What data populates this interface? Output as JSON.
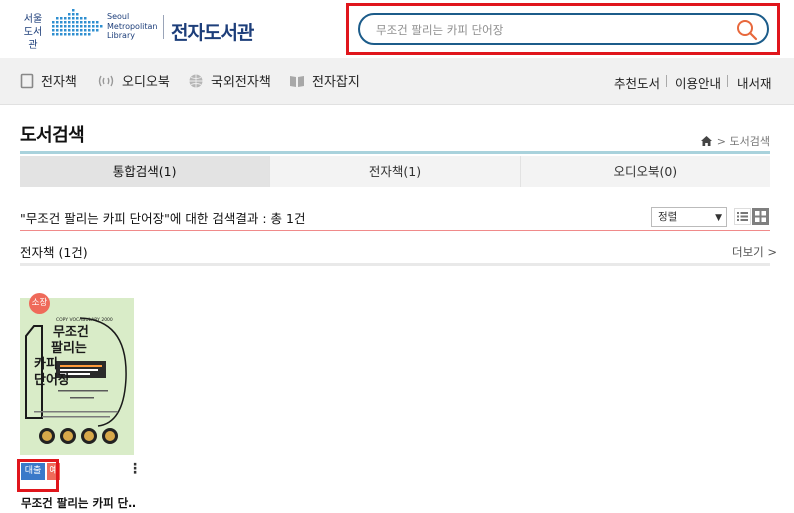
{
  "logo": {
    "korean_line1": "서울",
    "korean_line2": "도서관",
    "english_line1": "Seoul",
    "english_line2": "Metropolitan",
    "english_line3": "Library",
    "title": "전자도서관"
  },
  "search": {
    "placeholder": "무조건 팔리는 카피 단어장",
    "icon": "search-icon",
    "border_color": "#1c5c8a"
  },
  "nav": {
    "items": [
      {
        "label": "전자책",
        "icon": "ebook-icon"
      },
      {
        "label": "오디오북",
        "icon": "audio-icon"
      },
      {
        "label": "국외전자책",
        "icon": "globe-icon"
      },
      {
        "label": "전자잡지",
        "icon": "magazine-icon"
      }
    ],
    "right_links": [
      "추천도서",
      "이용안내",
      "내서재"
    ]
  },
  "page": {
    "title": "도서검색",
    "breadcrumb_current": "> 도서검색"
  },
  "tabs": [
    {
      "label": "통합검색(1)",
      "active": true
    },
    {
      "label": "전자책(1)",
      "active": false
    },
    {
      "label": "오디오북(0)",
      "active": false
    }
  ],
  "results": {
    "summary": "\"무조건 팔리는 카피 단어장\"에 대한 검색결과 : 총 1건",
    "sort_selected": "정렬",
    "section_title": "전자책 (1건)",
    "more_label": "더보기 >"
  },
  "book": {
    "badge": "소장",
    "title": "무조건 팔리는 카피 단…",
    "loan_label": "대출",
    "reserve_label": "예약",
    "cover": {
      "subtitle_en": "COPY VOCABULARY 2000",
      "title_line1": "무조건",
      "title_line2": "팔리는",
      "title_line3": "카피",
      "title_line4": "단어장",
      "cover_bg": "#d9ecc8"
    }
  },
  "colors": {
    "brand": "#1d3e7a",
    "accent_teal": "#a9d2dc",
    "loan_blue": "#3a79c9",
    "reserve_red": "#ef6a5a",
    "highlight_red": "#e0161c"
  }
}
